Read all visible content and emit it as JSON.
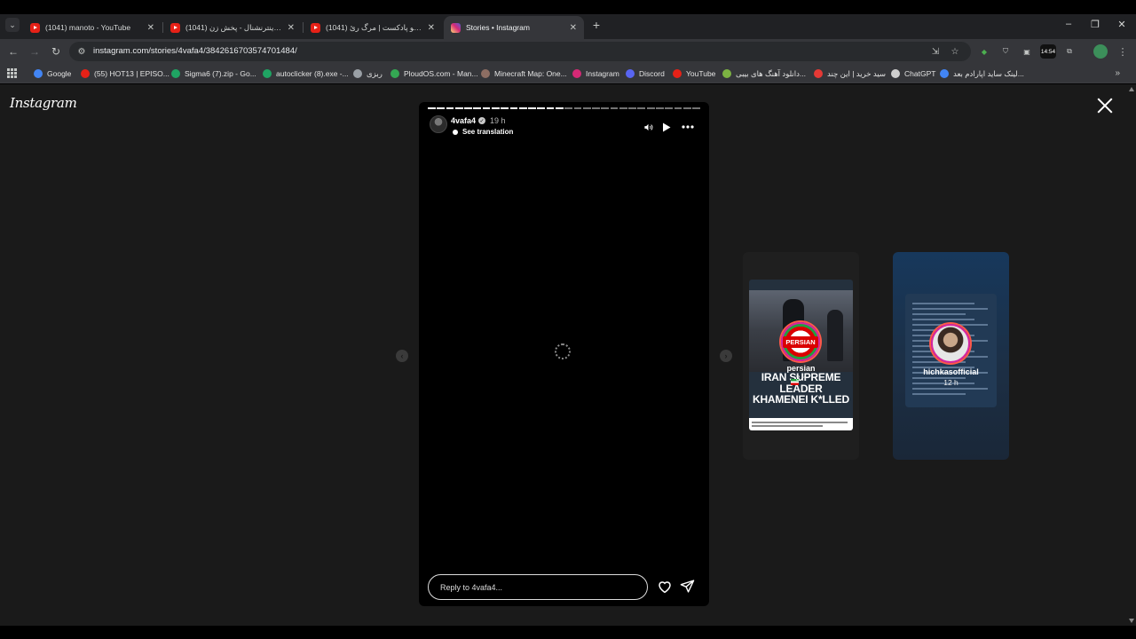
{
  "browser": {
    "tabs": [
      {
        "title": "(1041) manoto - YouTube",
        "favicon": "youtube-icon"
      },
      {
        "title": "(1041) ایران اینترنشنال - پخش زن...",
        "favicon": "youtube-icon"
      },
      {
        "title": "(1041) من‌وتو پادکست | مرگ رئ...",
        "favicon": "youtube-icon"
      },
      {
        "title": "Stories • Instagram",
        "favicon": "instagram-icon"
      }
    ],
    "url": "instagram.com/stories/4vafa4/3842616703574701484/",
    "clock_extension": "14:54",
    "bookmarks": [
      {
        "label": "Google",
        "color": "#4285f4"
      },
      {
        "label": "(55) HOT13 | EPISO...",
        "color": "#e62117"
      },
      {
        "label": "Sigma6 (7).zip - Go...",
        "color": "#1fa463"
      },
      {
        "label": "autoclicker (8).exe -...",
        "color": "#1fa463"
      },
      {
        "label": "ربزی",
        "color": "#9aa0a6"
      },
      {
        "label": "PloudOS.com - Man...",
        "color": "#34a853"
      },
      {
        "label": "Minecraft Map: One...",
        "color": "#8d6e63"
      },
      {
        "label": "Instagram",
        "color": "#d62976"
      },
      {
        "label": "Discord",
        "color": "#5865f2"
      },
      {
        "label": "YouTube",
        "color": "#e62117"
      },
      {
        "label": "دانلود آهنگ های بیبی...",
        "color": "#7cb342"
      },
      {
        "label": "سید خرید | این چند",
        "color": "#e53935"
      },
      {
        "label": "ChatGPT",
        "color": "#cfcfcf"
      },
      {
        "label": "لینک ساید اپارادم بعد...",
        "color": "#4285f4"
      }
    ]
  },
  "instagram": {
    "logo": "Instagram",
    "story": {
      "username": "4vafa4",
      "time_ago": "19 h",
      "see_translation": "See translation",
      "reply_placeholder": "Reply to 4vafa4...",
      "progress_segments": 30,
      "progress_done": 15
    },
    "previews": [
      {
        "username": "persian",
        "time_ago": "3 h",
        "badge": "PERSIAN",
        "headline": "IRAN SUPREME LEADER KHAMENEI K*LLED"
      },
      {
        "username": "hichkasofficial",
        "time_ago": "12 h"
      }
    ]
  },
  "colors": {
    "page_bg": "#1a1a1a",
    "youtube_red": "#e62117",
    "ring": "#d6249f"
  }
}
